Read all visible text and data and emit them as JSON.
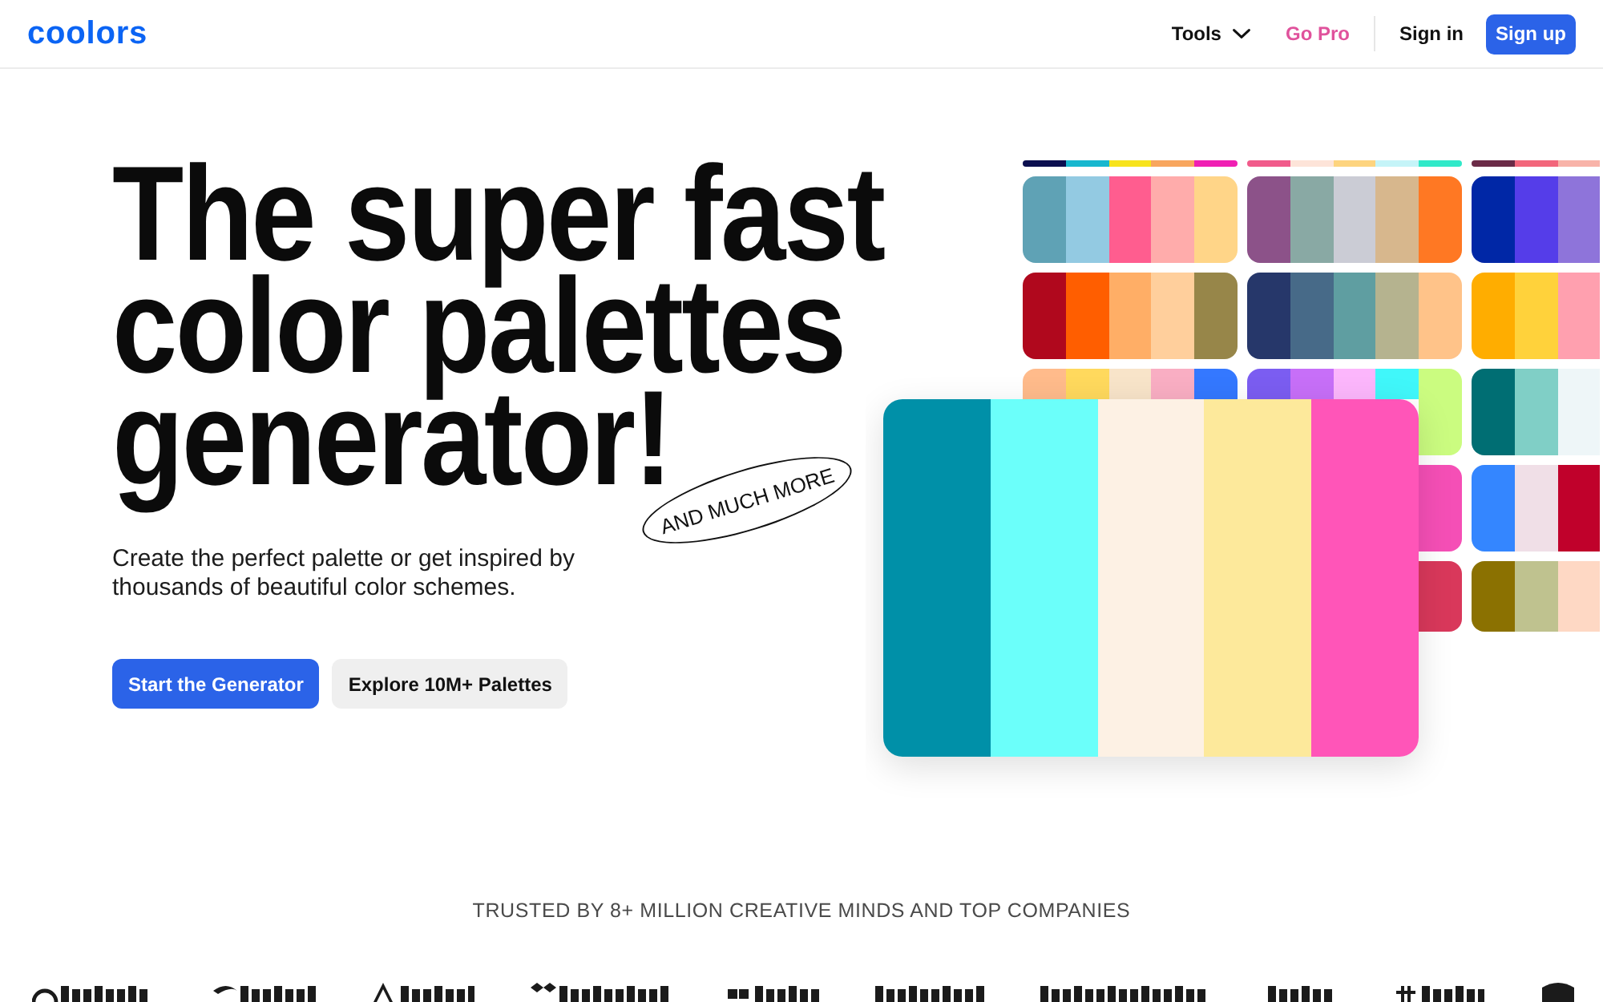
{
  "header": {
    "logo": "coolors",
    "nav": [
      {
        "label": "Tools",
        "kind": "menu"
      },
      {
        "label": "Go Pro",
        "kind": "promo"
      },
      {
        "label": "Sign in",
        "kind": "link"
      },
      {
        "label": "Sign up",
        "kind": "button"
      }
    ]
  },
  "hero": {
    "heading_lines": [
      "The super fast",
      "color palettes",
      "generator!"
    ],
    "badge": "AND MUCH MORE",
    "description": "Create the perfect palette or get inspired by thousands of beautiful color schemes.",
    "buttons": [
      {
        "label": "Start the Generator",
        "kind": "primary"
      },
      {
        "label": "Explore 10M+ Palettes",
        "kind": "secondary"
      }
    ],
    "palette_grid": {
      "columns": [
        {
          "palettes": [
            {
              "colors": [
                {
                  "color": "#0b0f4f",
                  "kind": "full"
                },
                {
                  "color": "#17b7cf",
                  "kind": "full"
                },
                {
                  "color": "#f7e31c",
                  "kind": "full"
                },
                {
                  "color": "#f8a65e",
                  "kind": "full"
                },
                {
                  "color": "#f01fb3",
                  "kind": "full"
                }
              ]
            },
            {
              "colors": [
                {
                  "color": "#5fa2b5",
                  "kind": "full"
                },
                {
                  "color": "#93cae2",
                  "kind": "full"
                },
                {
                  "color": "#ff5d8f",
                  "kind": "full"
                },
                {
                  "color": "#ffacab",
                  "kind": "full"
                },
                {
                  "color": "#ffd588",
                  "kind": "full"
                }
              ]
            },
            {
              "colors": [
                {
                  "color": "#b0081d",
                  "kind": "full"
                },
                {
                  "color": "#ff5e00",
                  "kind": "full"
                },
                {
                  "color": "#ffae66",
                  "kind": "full"
                },
                {
                  "color": "#ffcf9c",
                  "kind": "full"
                },
                {
                  "color": "#978649",
                  "kind": "full"
                }
              ]
            },
            {
              "colors": [
                {
                  "color": "#ffbb8b",
                  "kind": "top"
                },
                {
                  "color": "#ffd95d",
                  "kind": "top"
                },
                {
                  "color": "#f8e4c9",
                  "kind": "top"
                },
                {
                  "color": "#f9aec3",
                  "kind": "top"
                },
                {
                  "color": "#3478ff",
                  "kind": "top"
                }
              ]
            }
          ]
        },
        {
          "palettes": [
            {
              "colors": [
                {
                  "color": "#f15b8b",
                  "kind": "full"
                },
                {
                  "color": "#fde4d9",
                  "kind": "full"
                },
                {
                  "color": "#fdd47f",
                  "kind": "full"
                },
                {
                  "color": "#c5f4f8",
                  "kind": "full"
                },
                {
                  "color": "#31e9c9",
                  "kind": "full"
                }
              ]
            },
            {
              "colors": [
                {
                  "color": "#8c5289",
                  "kind": "full"
                },
                {
                  "color": "#89a9a4",
                  "kind": "full"
                },
                {
                  "color": "#cbccd5",
                  "kind": "full"
                },
                {
                  "color": "#d7b78d",
                  "kind": "full"
                },
                {
                  "color": "#ff7823",
                  "kind": "full"
                }
              ]
            },
            {
              "colors": [
                {
                  "color": "#26376a",
                  "kind": "full"
                },
                {
                  "color": "#476a88",
                  "kind": "full"
                },
                {
                  "color": "#5f9ea1",
                  "kind": "full"
                },
                {
                  "color": "#b5b38f",
                  "kind": "full"
                },
                {
                  "color": "#ffc389",
                  "kind": "full"
                }
              ]
            },
            {
              "colors": [
                {
                  "color": "#7b5df1",
                  "kind": "top"
                },
                {
                  "color": "#c76ff8",
                  "kind": "top"
                },
                {
                  "color": "#fcb6fc",
                  "kind": "top"
                },
                {
                  "color": "#40f7fa",
                  "kind": "top"
                },
                {
                  "color": "#cbfc80",
                  "kind": "full"
                }
              ]
            },
            {
              "colors": [
                {
                  "color": "#f54fb6",
                  "kind": "end"
                }
              ]
            },
            {
              "colors": [
                {
                  "color": "#d9385b",
                  "kind": "end"
                }
              ]
            }
          ]
        },
        {
          "palettes": [
            {
              "colors": [
                {
                  "color": "#6b2b47",
                  "kind": "full"
                },
                {
                  "color": "#f2667b",
                  "kind": "full"
                },
                {
                  "color": "#f8b3a9",
                  "kind": "full"
                }
              ]
            },
            {
              "colors": [
                {
                  "color": "#0027a6",
                  "kind": "full"
                },
                {
                  "color": "#553de9",
                  "kind": "full"
                },
                {
                  "color": "#8e74da",
                  "kind": "full"
                }
              ]
            },
            {
              "colors": [
                {
                  "color": "#ffad00",
                  "kind": "full"
                },
                {
                  "color": "#ffd23b",
                  "kind": "full"
                },
                {
                  "color": "#ffa0af",
                  "kind": "full"
                }
              ]
            },
            {
              "colors": [
                {
                  "color": "#006e73",
                  "kind": "full"
                },
                {
                  "color": "#80cfc6",
                  "kind": "full"
                },
                {
                  "color": "#eef6f8",
                  "kind": "full"
                }
              ]
            },
            {
              "colors": [
                {
                  "color": "#3486ff",
                  "kind": "full"
                },
                {
                  "color": "#f0dfe7",
                  "kind": "full"
                },
                {
                  "color": "#c0012b",
                  "kind": "full"
                }
              ]
            },
            {
              "colors": [
                {
                  "color": "#8b7101",
                  "kind": "full"
                },
                {
                  "color": "#bfc28f",
                  "kind": "full"
                },
                {
                  "color": "#fed8c4",
                  "kind": "full"
                }
              ]
            }
          ]
        }
      ]
    },
    "featured_palette": {
      "colors": [
        {
          "color": "#0090a8"
        },
        {
          "color": "#6bfffa"
        },
        {
          "color": "#fdf1e4"
        },
        {
          "color": "#fde99b"
        },
        {
          "color": "#ff55b8"
        }
      ]
    }
  },
  "trusted": {
    "title": "TRUSTED BY 8+ MILLION CREATIVE MINDS AND TOP COMPANIES"
  }
}
